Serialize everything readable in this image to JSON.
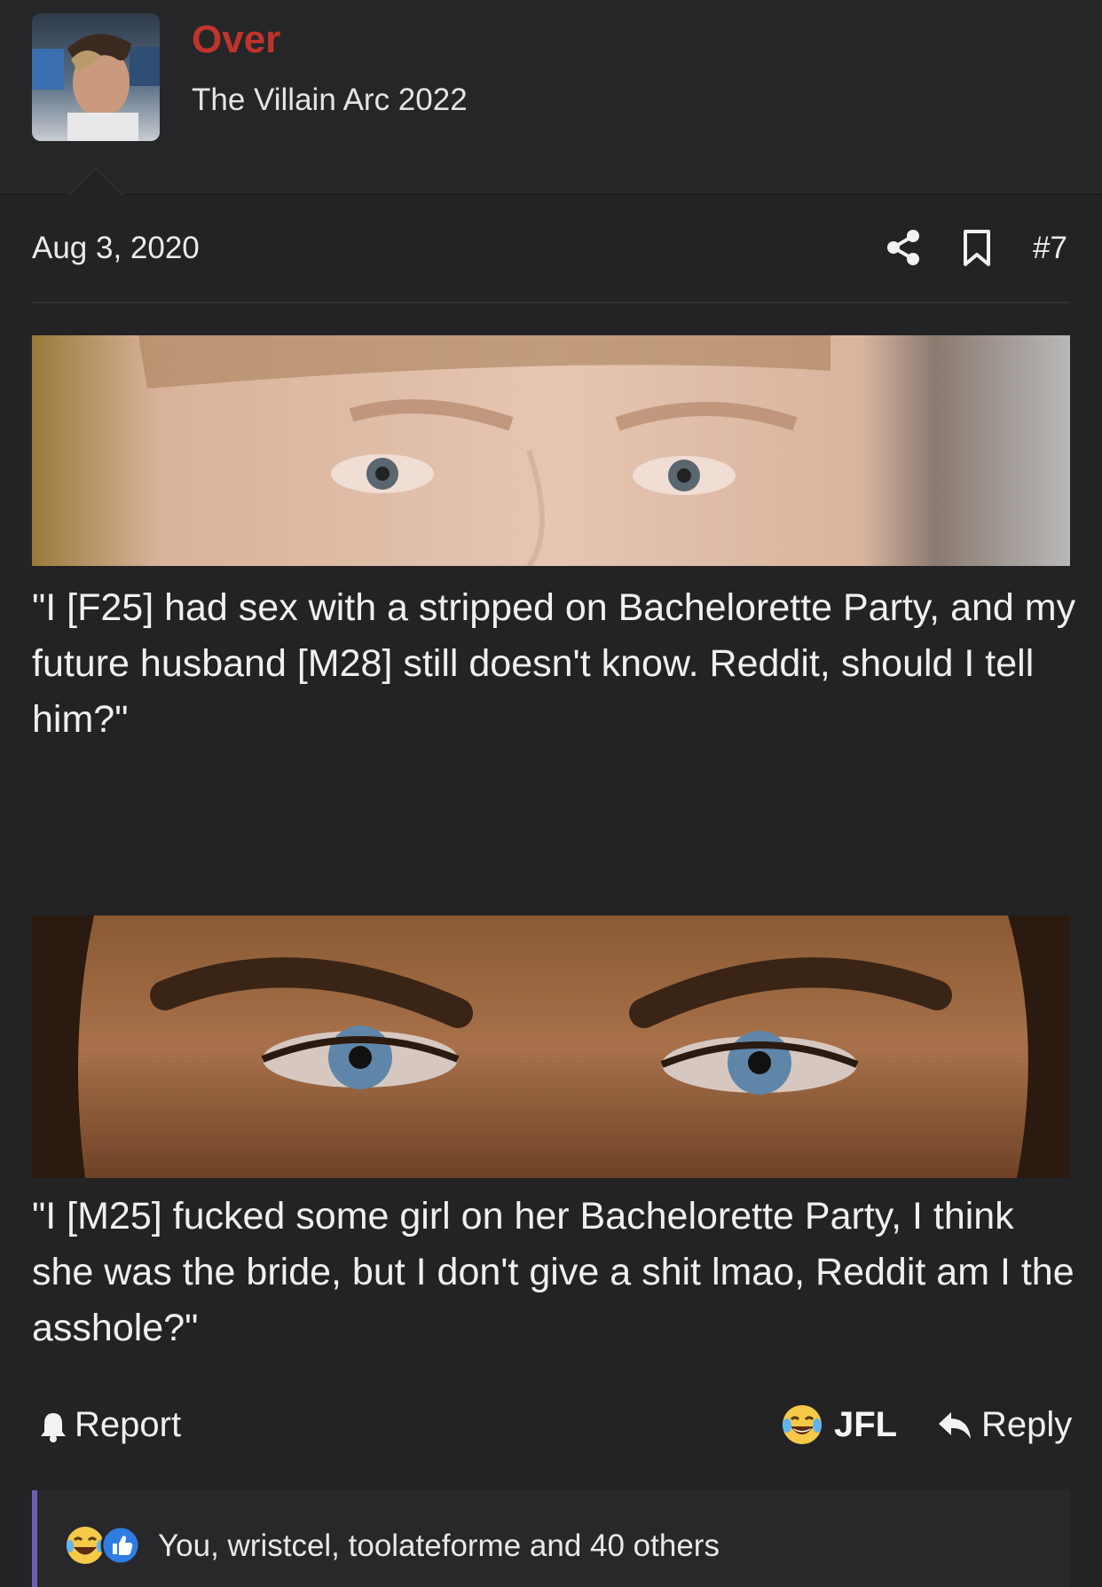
{
  "author": {
    "name": "Over",
    "title": "The Villain Arc 2022",
    "name_color": "#c0342b"
  },
  "post": {
    "date": "Aug 3, 2020",
    "number": "#7",
    "quote_1": "\"I [F25] had sex with a stripped on Bachelorette Party, and my future husband [M28] still doesn't know. Reddit, should I tell him?\"",
    "quote_2": "\"I [M25] fucked some girl on her Bachelorette Party, I think she was the bride, but I don't give a shit lmao, Reddit am I the asshole?\""
  },
  "icons": {
    "share": "share-icon",
    "bookmark": "bookmark-icon",
    "report": "bell-icon",
    "reaction": "laughing-crying-emoji",
    "reply": "reply-arrow-icon",
    "like": "thumbs-up-icon"
  },
  "actions": {
    "report_label": "Report",
    "reaction_label": "JFL",
    "reply_label": "Reply"
  },
  "reactions": {
    "summary": "You, wristcel, toolateforme and 40 others"
  },
  "colors": {
    "background": "#232325",
    "accent_bar": "#6b5fb5"
  }
}
